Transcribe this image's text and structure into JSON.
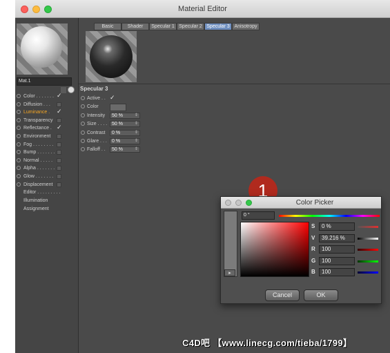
{
  "window": {
    "title": "Material Editor"
  },
  "material": {
    "name": "Mat.1"
  },
  "channels": [
    {
      "label": "Color",
      "dots": " . . . . . . .",
      "checked": true
    },
    {
      "label": "Diffusion",
      "dots": " . . .",
      "checked": false
    },
    {
      "label": "Luminance",
      "dots": " .",
      "checked": true,
      "active": true
    },
    {
      "label": "Transparency",
      "dots": "",
      "checked": false
    },
    {
      "label": "Reflectance",
      "dots": " .",
      "checked": true
    },
    {
      "label": "Environment",
      "dots": "",
      "checked": false
    },
    {
      "label": "Fog",
      "dots": " . . . . . . . .",
      "checked": false
    },
    {
      "label": "Bump",
      "dots": " . . . . . . .",
      "checked": false
    },
    {
      "label": "Normal",
      "dots": " . . . . .",
      "checked": false
    },
    {
      "label": "Alpha",
      "dots": " . . . . . . .",
      "checked": false
    },
    {
      "label": "Glow",
      "dots": " . . . . . . .",
      "checked": false
    },
    {
      "label": "Displacement",
      "dots": "",
      "checked": false
    }
  ],
  "sub_items": [
    "Editor . . . . . . . . .",
    "Illumination",
    "Assignment"
  ],
  "tabs": [
    "Basic",
    "Shader",
    "Specular 1",
    "Specular 2",
    "Specular 3",
    "Anisotropy"
  ],
  "section": {
    "title": "Specular 3"
  },
  "props": [
    {
      "label": "Active . .",
      "type": "check"
    },
    {
      "label": "Color",
      "type": "color"
    },
    {
      "label": "Intensity",
      "value": "50 %"
    },
    {
      "label": "Size . . . .",
      "value": "50 %"
    },
    {
      "label": "Contrast",
      "value": "0 %"
    },
    {
      "label": "Glare . . .",
      "value": "0 %"
    },
    {
      "label": "Falloff . .",
      "value": "50 %"
    }
  ],
  "color_picker": {
    "title": "Color Picker",
    "hue_value": "0 °",
    "fields": [
      {
        "label": "S",
        "value": "0 %"
      },
      {
        "label": "V",
        "value": "39.216 %"
      },
      {
        "label": "R",
        "value": "100"
      },
      {
        "label": "G",
        "value": "100"
      },
      {
        "label": "B",
        "value": "100"
      }
    ],
    "cancel_label": "Cancel",
    "ok_label": "OK",
    "arrow_glyph": "▸"
  },
  "badge": {
    "number": "1"
  },
  "watermark": "C4D吧 【www.linecg.com/tieba/1799】",
  "colors": {
    "accent": "#f5a623",
    "tab_selected": "#6f8fbf",
    "badge": "#b02a1e"
  }
}
